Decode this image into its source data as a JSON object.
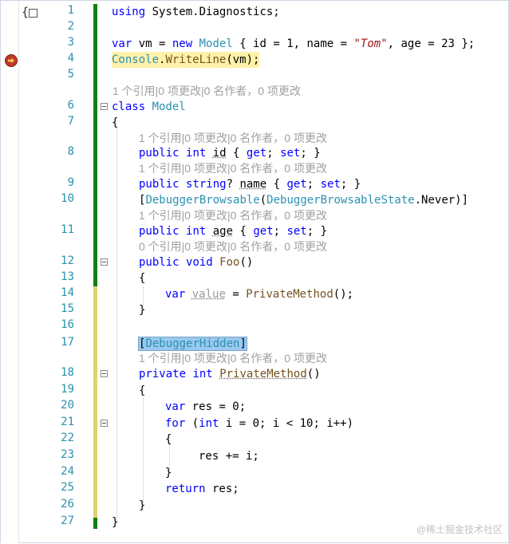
{
  "editor": {
    "top_left_glyph": "{",
    "watermark": "@稀土掘金技术社区",
    "code_lens": {
      "ref1": "1 个引用|0 项更改|0 名作者，0 项更改",
      "ref0": "0 个引用|0 项更改|0 名作者，0 项更改"
    },
    "lines": [
      {
        "n": "1",
        "t": "using System.Diagnostics;"
      },
      {
        "n": "2",
        "t": ""
      },
      {
        "n": "3",
        "t": "var vm = new Model { id = 1, name = \"Tom\", age = 23 };"
      },
      {
        "n": "4",
        "t": "Console.WriteLine(vm);"
      },
      {
        "n": "5",
        "t": ""
      },
      {
        "n": "6",
        "t": "class Model"
      },
      {
        "n": "7",
        "t": "{"
      },
      {
        "n": "8",
        "t": "public int id { get; set; }"
      },
      {
        "n": "9",
        "t": "public string? name { get; set; }"
      },
      {
        "n": "10",
        "t": "[DebuggerBrowsable(DebuggerBrowsableState.Never)]"
      },
      {
        "n": "11",
        "t": "public int age { get; set; }"
      },
      {
        "n": "12",
        "t": "public void Foo()"
      },
      {
        "n": "13",
        "t": "{"
      },
      {
        "n": "14",
        "t": "var value = PrivateMethod();"
      },
      {
        "n": "15",
        "t": "}"
      },
      {
        "n": "16",
        "t": ""
      },
      {
        "n": "17",
        "t": "[DebuggerHidden]"
      },
      {
        "n": "18",
        "t": "private int PrivateMethod()"
      },
      {
        "n": "19",
        "t": "{"
      },
      {
        "n": "20",
        "t": "var res = 0;"
      },
      {
        "n": "21",
        "t": "for (int i = 0; i < 10; i++)"
      },
      {
        "n": "22",
        "t": "{"
      },
      {
        "n": "23",
        "t": "res += i;"
      },
      {
        "n": "24",
        "t": "}"
      },
      {
        "n": "25",
        "t": "return res;"
      },
      {
        "n": "26",
        "t": "}"
      },
      {
        "n": "27",
        "t": "}"
      }
    ]
  }
}
